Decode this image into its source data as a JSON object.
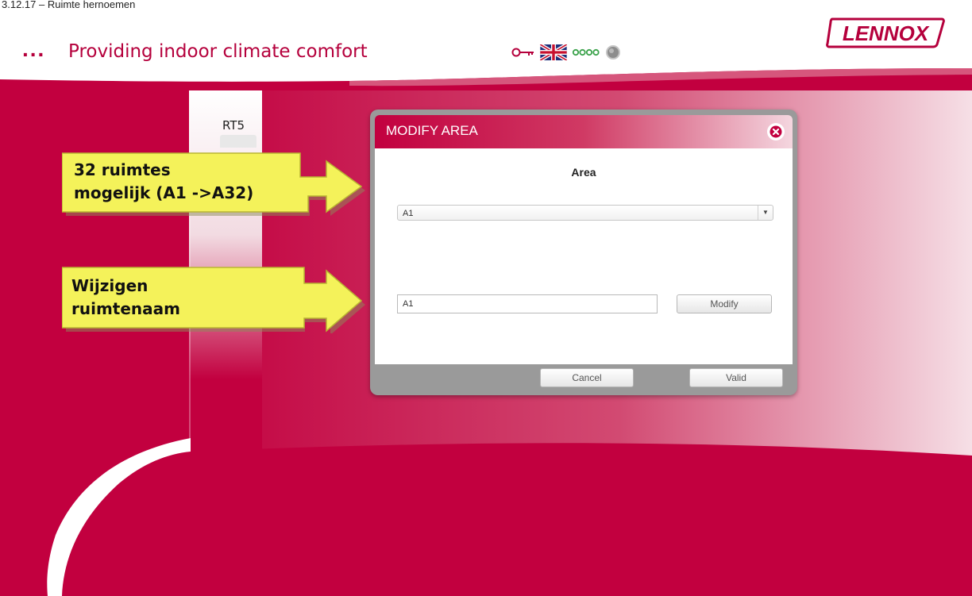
{
  "document": {
    "header_text": "3.12.17 – Ruimte hernoemen"
  },
  "app": {
    "tagline_dots": "...",
    "tagline": "Providing indoor climate comfort",
    "brand": "LENNOX"
  },
  "status_icons": [
    "key-icon",
    "uk-flag-icon",
    "connection-dots-icon",
    "status-led-icon"
  ],
  "sidebar": {
    "unit_label": "RT5"
  },
  "dialog": {
    "title": "MODIFY AREA",
    "area_label": "Area",
    "area_select": {
      "selected": "A1"
    },
    "name_input": {
      "value": "A1"
    },
    "modify_label": "Modify",
    "cancel_label": "Cancel",
    "valid_label": "Valid"
  },
  "callouts": [
    {
      "line1": "32 ruimtes",
      "line2": "mogelijk (A1 ->A32)"
    },
    {
      "line1": "Wijzigen",
      "line2": "ruimtenaam"
    }
  ],
  "colors": {
    "brand_red": "#c2003f",
    "callout_yellow": "#f4f25a"
  }
}
